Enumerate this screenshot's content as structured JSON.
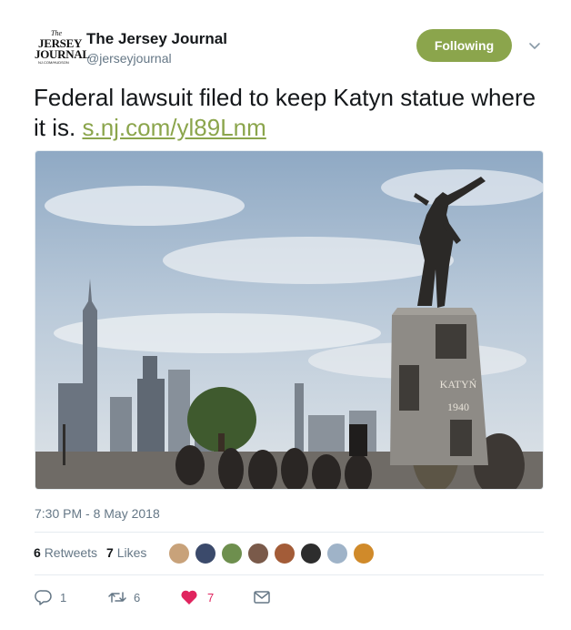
{
  "account": {
    "logo_text": {
      "the": "The",
      "line1": "JERSEY",
      "line2": "JOURNAL",
      "small": "NJ.COM/HUDSON"
    },
    "name": "The Jersey Journal",
    "handle": "@jerseyjournal",
    "follow_label": "Following"
  },
  "tweet": {
    "text": "Federal lawsuit filed to keep Katyn statue where it is.",
    "link": "s.nj.com/yl89Lnm",
    "image": {
      "plinth_line1": "KATYŃ",
      "plinth_line2": "1940"
    },
    "timestamp": "7:30 PM - 8 May 2018"
  },
  "stats": {
    "retweets_count": "6",
    "retweets_label": "Retweets",
    "likes_count": "7",
    "likes_label": "Likes"
  },
  "actions": {
    "reply_count": "1",
    "retweet_count": "6",
    "like_count": "7"
  },
  "colors": {
    "accent": "#8ba54c",
    "heart": "#e0245e",
    "muted": "#657786"
  }
}
